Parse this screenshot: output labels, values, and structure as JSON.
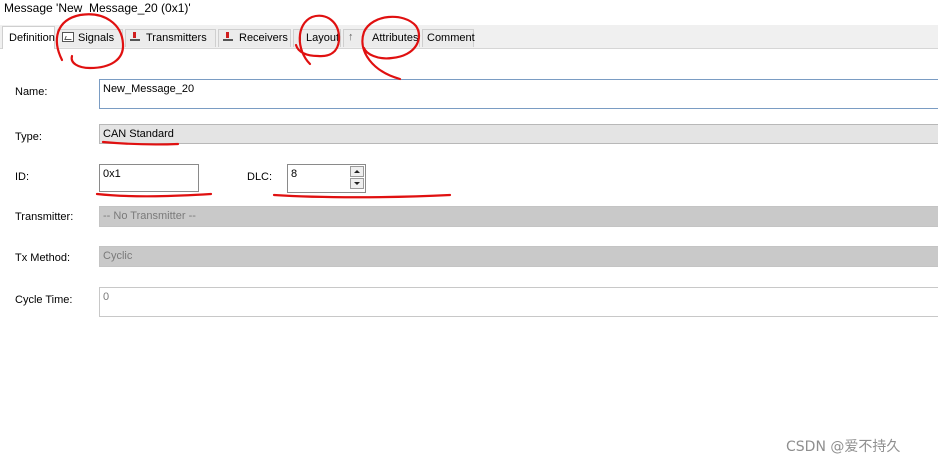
{
  "window": {
    "title": "Message 'New_Message_20 (0x1)'"
  },
  "tabs": [
    {
      "label": "Definition",
      "icon": "none"
    },
    {
      "label": "Signals",
      "icon": "signal-icon"
    },
    {
      "label": "Transmitters",
      "icon": "node-icon"
    },
    {
      "label": "Receivers",
      "icon": "node-icon"
    },
    {
      "label": "Layout",
      "icon": "layout-icon"
    },
    {
      "label": "Attributes",
      "icon": "attribute-icon"
    },
    {
      "label": "Comment",
      "icon": "none"
    }
  ],
  "form": {
    "name": {
      "label": "Name:",
      "value": "New_Message_20"
    },
    "type": {
      "label": "Type:",
      "value": "CAN Standard"
    },
    "id": {
      "label": "ID:",
      "value": "0x1"
    },
    "dlc": {
      "label": "DLC:",
      "value": "8"
    },
    "transmitter": {
      "label": "Transmitter:",
      "value": "-- No Transmitter --"
    },
    "tx_method": {
      "label": "Tx Method:",
      "value": "Cyclic"
    },
    "cycle_time": {
      "label": "Cycle Time:",
      "value": "0"
    }
  },
  "watermark": "CSDN @爱不持久",
  "colors": {
    "annotation": "#e01010",
    "field_border": "#7a9cc3",
    "disabled_bg": "#c9c9c9"
  }
}
